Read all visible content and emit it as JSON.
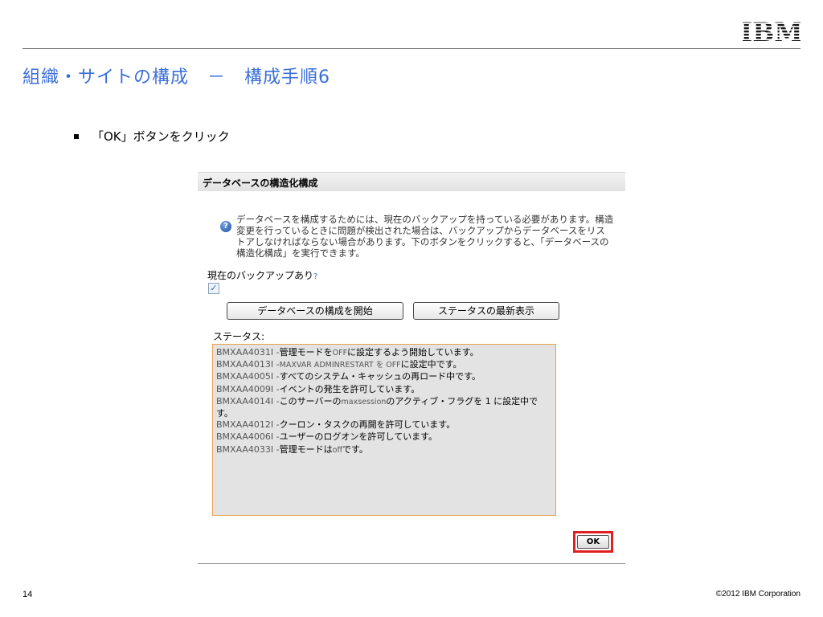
{
  "slide": {
    "logo_text": "IBM",
    "title": "組織・サイトの構成　－　構成手順6",
    "bullet": "「OK」ボタンをクリック",
    "page_number": "14",
    "copyright": "©2012 IBM Corporation",
    "accent_color": "#3b6fd8"
  },
  "dialog": {
    "title": "データベースの構造化構成",
    "info_icon": "question-info-icon",
    "info_text": "データベースを構成するためには、現在のバックアップを持っている必要があります。構造変更を行っているときに問題が検出された場合は、バックアップからデータベースをリストアしなければならない場合があります。下のボタンをクリックすると、「データベースの構造化構成」を実行できます。",
    "backup_label": "現在のバックアップあり",
    "backup_help": "?",
    "backup_checked": true,
    "checkbox_glyph": "✓",
    "start_button": "データベースの構成を開始",
    "refresh_button": "ステータスの最新表示",
    "status_label": "ステータス:",
    "status_lines": [
      {
        "code": "BMXAA4031I -",
        "text": "管理モードを",
        "kw": "OFF",
        "rest": "に設定するよう開始しています。"
      },
      {
        "code": "BMXAA4013I -",
        "text": "",
        "kw": "MAXVAR ADMINRESTART を OFF",
        "rest": "に設定中です。"
      },
      {
        "code": "BMXAA4005I -",
        "text": "すべてのシステム・キャッシュの再ロード中です。",
        "kw": "",
        "rest": ""
      },
      {
        "code": "BMXAA4009I -",
        "text": "イベントの発生を許可しています。",
        "kw": "",
        "rest": ""
      },
      {
        "code": "BMXAA4014I -",
        "text": "このサーバーの",
        "kw": "maxsession",
        "rest": "のアクティブ・フラグを 1 に設定中です。"
      },
      {
        "code": "BMXAA4012I -",
        "text": "クーロン・タスクの再開を許可しています。",
        "kw": "",
        "rest": ""
      },
      {
        "code": "BMXAA4006I -",
        "text": "ユーザーのログオンを許可しています。",
        "kw": "",
        "rest": ""
      },
      {
        "code": "BMXAA4033I -",
        "text": "管理モードは",
        "kw": "off",
        "rest": "です。"
      }
    ],
    "ok_button": "OK",
    "highlight_color": "#e02020"
  }
}
